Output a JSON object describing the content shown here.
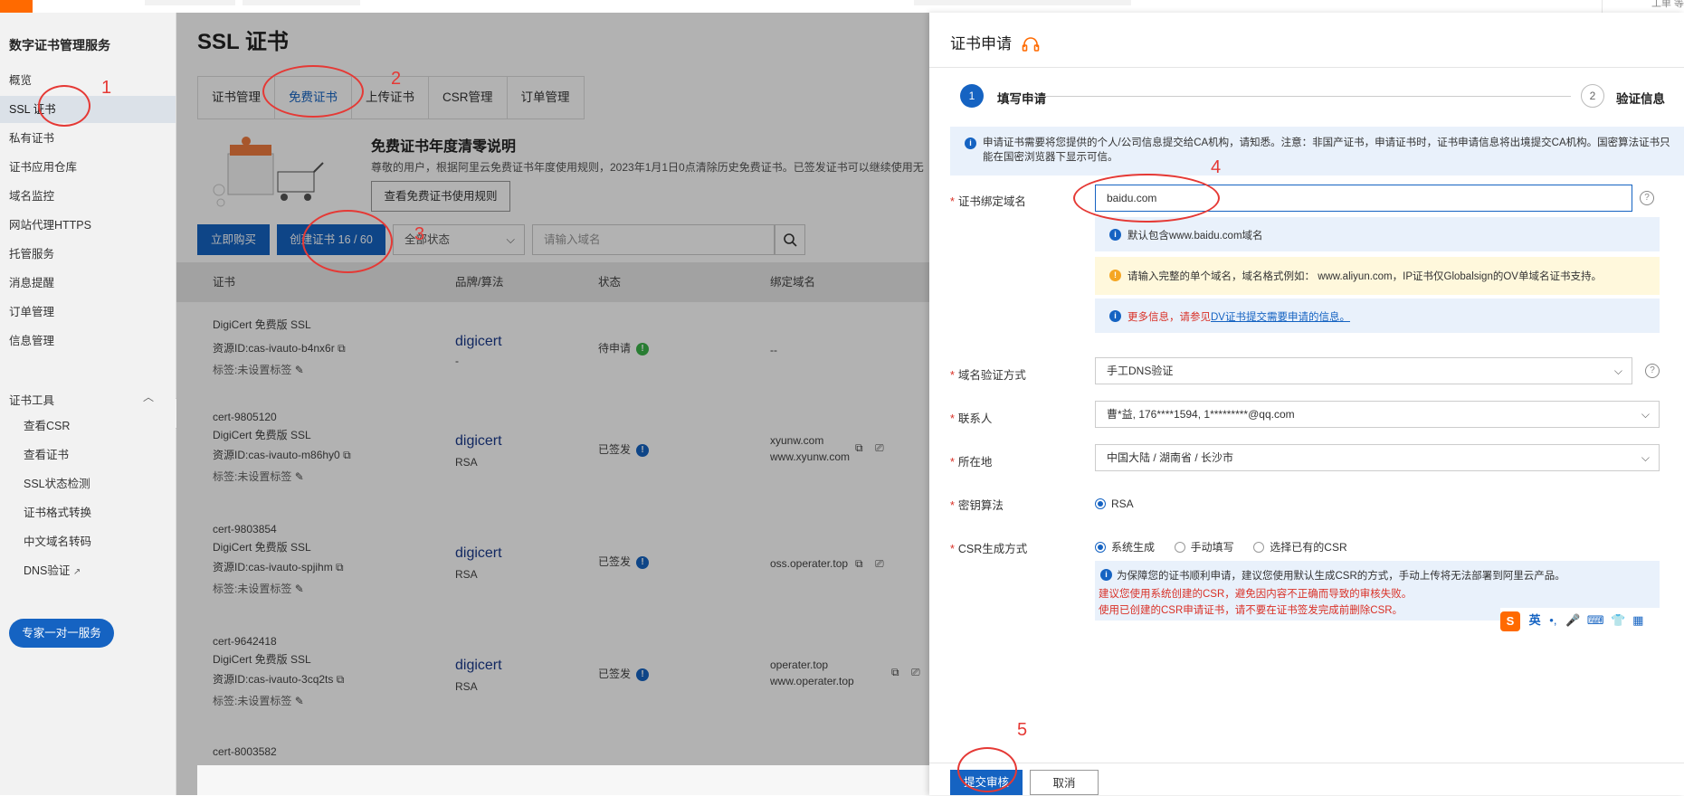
{
  "topbar": {
    "user_text": "工单 等"
  },
  "sidebar": {
    "title": "数字证书管理服务",
    "items": [
      {
        "label": "概览"
      },
      {
        "label": "SSL 证书"
      },
      {
        "label": "私有证书"
      },
      {
        "label": "证书应用仓库"
      },
      {
        "label": "域名监控"
      },
      {
        "label": "网站代理HTTPS"
      },
      {
        "label": "托管服务"
      },
      {
        "label": "消息提醒"
      },
      {
        "label": "订单管理"
      },
      {
        "label": "信息管理"
      }
    ],
    "group_label": "证书工具",
    "tools": [
      {
        "label": "查看CSR"
      },
      {
        "label": "查看证书"
      },
      {
        "label": "SSL状态检测"
      },
      {
        "label": "证书格式转换"
      },
      {
        "label": "中文域名转码"
      },
      {
        "label": "DNS验证"
      }
    ],
    "expert_button": "专家一对一服务"
  },
  "main": {
    "page_title": "SSL 证书",
    "tabs": [
      {
        "label": "证书管理"
      },
      {
        "label": "免费证书"
      },
      {
        "label": "上传证书"
      },
      {
        "label": "CSR管理"
      },
      {
        "label": "订单管理"
      }
    ],
    "promo": {
      "title": "免费证书年度清零说明",
      "text": "尊敬的用户，根据阿里云免费证书年度使用规则，2023年1月1日0点清除历史免费证书。已签发证书可以继续使用无",
      "button": "查看免费证书使用规则"
    },
    "buttons": {
      "buy": "立即购买",
      "create": "创建证书 16 / 60"
    },
    "status_select": "全部状态",
    "search_placeholder": "请输入域名",
    "columns": [
      "证书",
      "品牌/算法",
      "状态",
      "绑定域名"
    ],
    "rows": [
      {
        "id": "",
        "name": "DigiCert 免费版 SSL",
        "resource": "资源ID:cas-ivauto-b4nx6r",
        "tag": "标签:未设置标签",
        "brand": "digicert",
        "algo": "-",
        "status": "待申请",
        "domains": [
          "--"
        ]
      },
      {
        "id": "cert-9805120",
        "name": "DigiCert 免费版 SSL",
        "resource": "资源ID:cas-ivauto-m86hy0",
        "tag": "标签:未设置标签",
        "brand": "digicert",
        "algo": "RSA",
        "status": "已签发",
        "domains": [
          "xyunw.com",
          "www.xyunw.com"
        ]
      },
      {
        "id": "cert-9803854",
        "name": "DigiCert 免费版 SSL",
        "resource": "资源ID:cas-ivauto-spjihm",
        "tag": "标签:未设置标签",
        "brand": "digicert",
        "algo": "RSA",
        "status": "已签发",
        "domains": [
          "oss.operater.top"
        ]
      },
      {
        "id": "cert-9642418",
        "name": "DigiCert 免费版 SSL",
        "resource": "资源ID:cas-ivauto-3cq2ts",
        "tag": "标签:未设置标签",
        "brand": "digicert",
        "algo": "RSA",
        "status": "已签发",
        "domains": [
          "operater.top",
          "www.operater.top"
        ]
      },
      {
        "id": "cert-8003582",
        "name": "",
        "resource": "",
        "tag": "",
        "brand": "",
        "algo": "",
        "status": "",
        "domains": []
      }
    ]
  },
  "drawer": {
    "title": "证书申请",
    "steps": [
      {
        "num": "1",
        "label": "填写申请"
      },
      {
        "num": "2",
        "label": "验证信息"
      }
    ],
    "notice": "申请证书需要将您提供的个人/公司信息提交给CA机构，请知悉。注意：非国产证书，申请证书时，证书申请信息将出境提交CA机构。国密算法证书只能在国密浏览器下显示可信。",
    "fields": {
      "domain_label": "证书绑定域名",
      "domain_value": "baidu.com",
      "hint_default": "默认包含www.baidu.com域名",
      "hint_warning": "请输入完整的单个域名，域名格式例如： www.aliyun.com，IP证书仅Globalsign的OV单域名证书支持。",
      "hint_more_prefix": "更多信息，请参见",
      "hint_more_link": "DV证书提交需要申请的信息。",
      "verify_label": "域名验证方式",
      "verify_value": "手工DNS验证",
      "contact_label": "联系人",
      "contact_value": "曹*益, 176****1594, 1*********@qq.com",
      "location_label": "所在地",
      "location_value": "中国大陆 / 湖南省 / 长沙市",
      "algo_label": "密钥算法",
      "algo_option": "RSA",
      "csr_label": "CSR生成方式",
      "csr_options": [
        "系统生成",
        "手动填写",
        "选择已有的CSR"
      ],
      "csr_info": "为保障您的证书顺利申请，建议您使用默认生成CSR的方式，手动上传将无法部署到阿里云产品。",
      "csr_warn1": "建议您使用系统创建的CSR，避免因内容不正确而导致的审核失败。",
      "csr_warn2": "使用已创建的CSR申请证书，请不要在证书签发完成前删除CSR。"
    },
    "ime": {
      "lang": "英"
    },
    "submit": "提交审核",
    "cancel": "取消"
  },
  "annotations": [
    "1",
    "2",
    "3",
    "4",
    "5"
  ],
  "colors": {
    "primary": "#1563c2",
    "brand": "#ff6a00",
    "annotation": "#e53935",
    "warning": "#f5a623"
  }
}
